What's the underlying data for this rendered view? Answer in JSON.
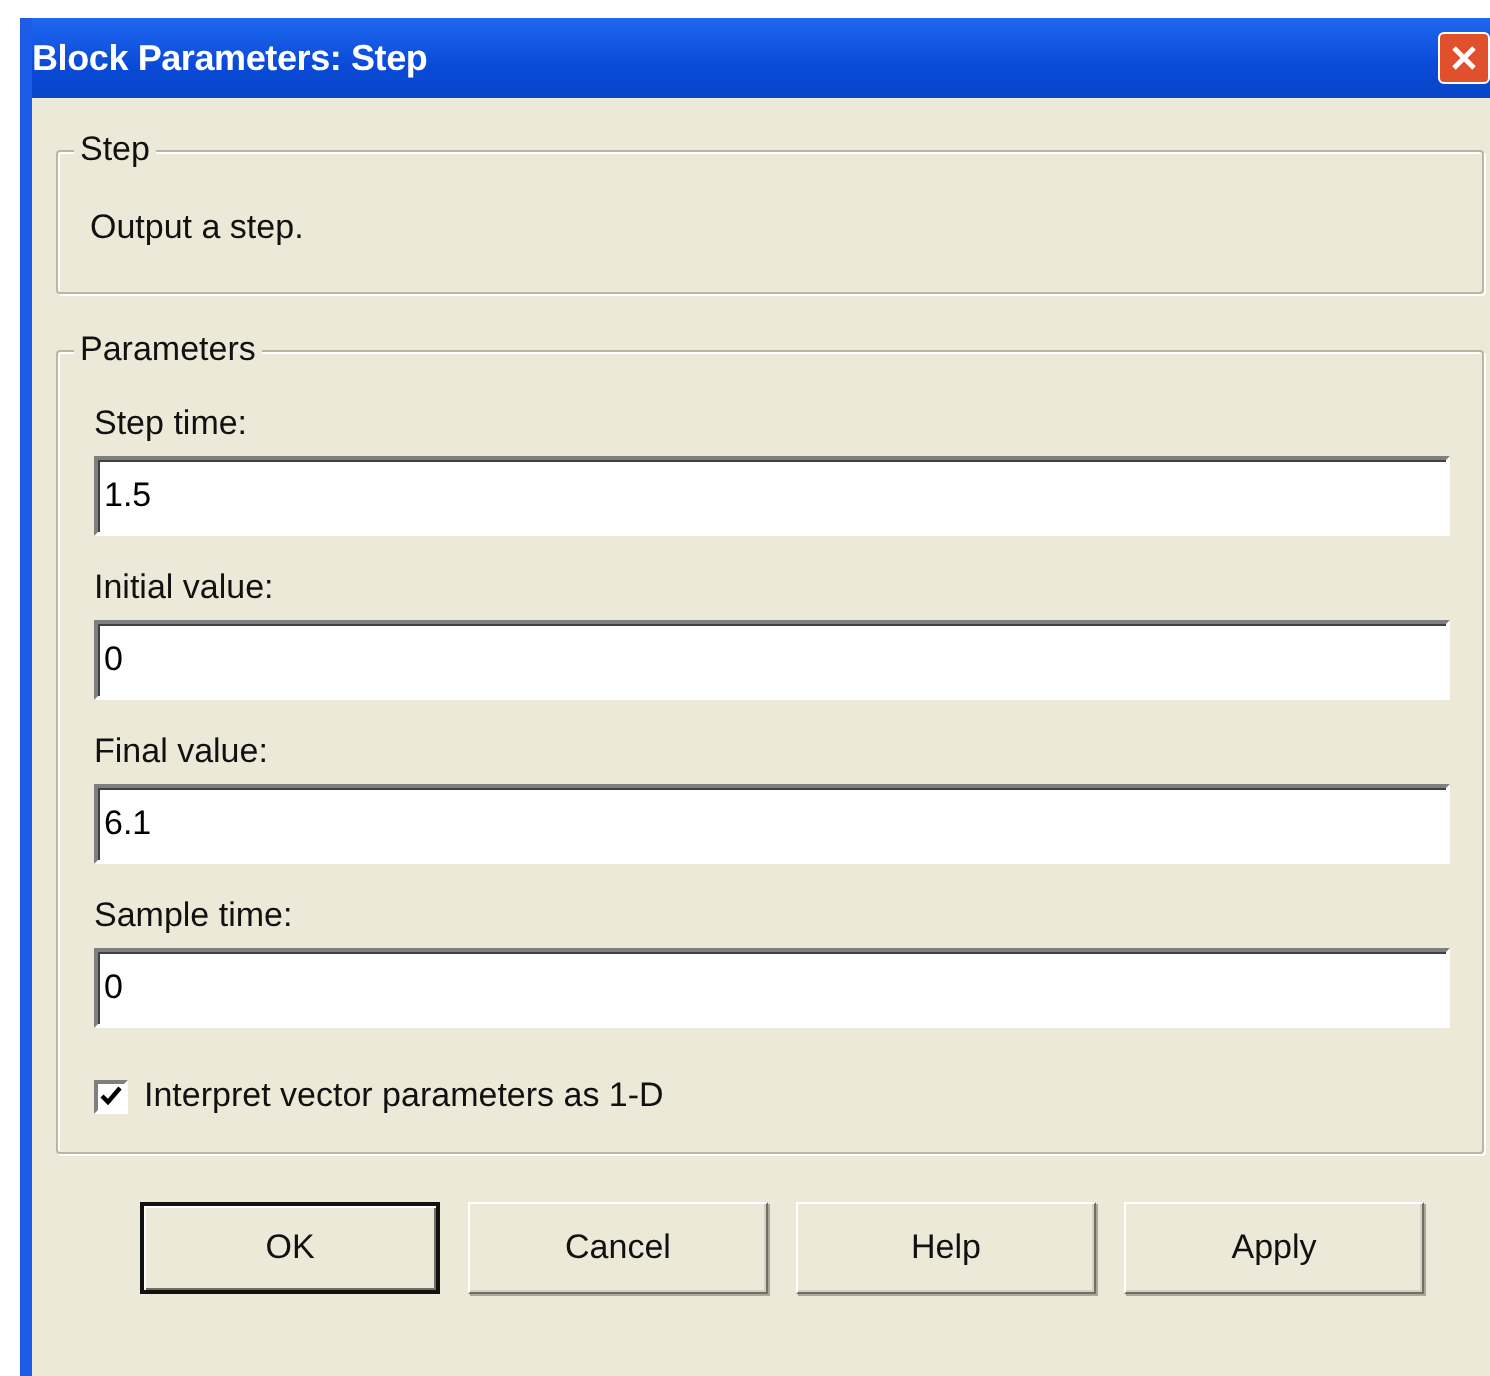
{
  "window": {
    "title": "Block Parameters: Step"
  },
  "description_group": {
    "title": "Step",
    "text": "Output a step."
  },
  "parameters_group": {
    "title": "Parameters",
    "fields": [
      {
        "label": "Step time:",
        "value": "1.5"
      },
      {
        "label": "Initial value:",
        "value": "0"
      },
      {
        "label": "Final value:",
        "value": "6.1"
      },
      {
        "label": "Sample time:",
        "value": "0"
      }
    ],
    "checkbox": {
      "label": "Interpret vector parameters as 1-D",
      "checked": true
    }
  },
  "buttons": [
    {
      "label": "OK",
      "default": true
    },
    {
      "label": "Cancel",
      "default": false
    },
    {
      "label": "Help",
      "default": false
    },
    {
      "label": "Apply",
      "default": false
    }
  ]
}
